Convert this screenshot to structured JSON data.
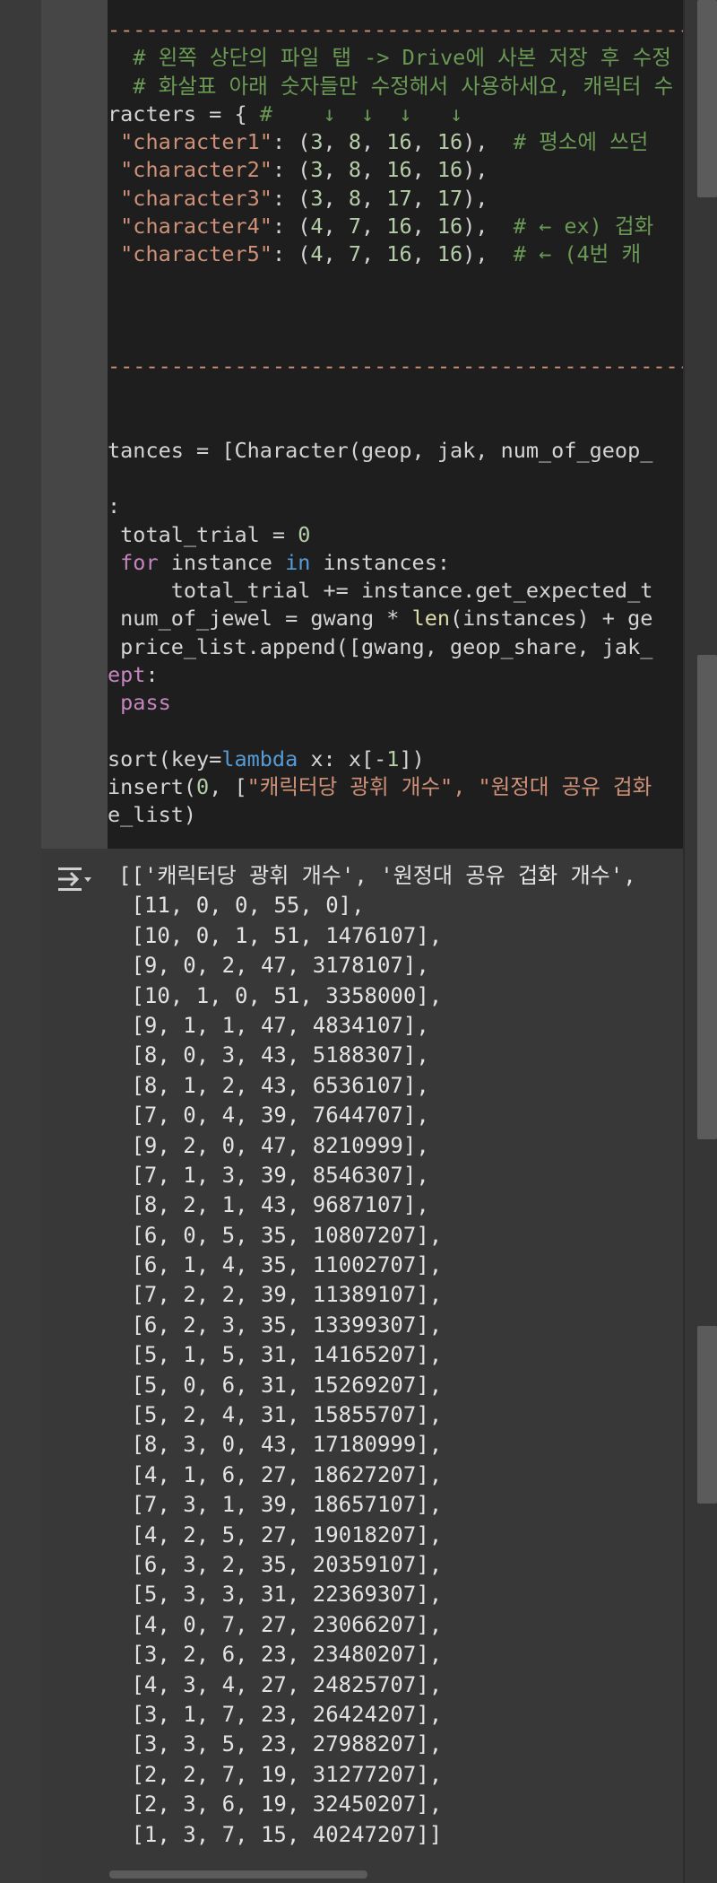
{
  "code_cell": {
    "lines": [
      {
        "segments": [
          {
            "t": "--------------------------------------------------------------",
            "c": "str"
          }
        ]
      },
      {
        "segments": [
          {
            "t": "  # 왼쪽 상단의 파일 탭 -> Drive에 사본 저장 후 수정",
            "c": "cm"
          }
        ]
      },
      {
        "segments": [
          {
            "t": "  # 화살표 아래 숫자들만 수정해서 사용하세요, 캐릭터 수",
            "c": "cm"
          }
        ]
      },
      {
        "segments": [
          {
            "t": "racters = { ",
            "c": ""
          },
          {
            "t": "#    ↓  ↓  ↓   ↓",
            "c": "cm"
          }
        ]
      },
      {
        "segments": [
          {
            "t": " \"character1\"",
            "c": "str"
          },
          {
            "t": ": (",
            "c": ""
          },
          {
            "t": "3",
            "c": "num"
          },
          {
            "t": ", ",
            "c": ""
          },
          {
            "t": "8",
            "c": "num"
          },
          {
            "t": ", ",
            "c": ""
          },
          {
            "t": "16",
            "c": "num"
          },
          {
            "t": ", ",
            "c": ""
          },
          {
            "t": "16",
            "c": "num"
          },
          {
            "t": "),  ",
            "c": ""
          },
          {
            "t": "# 평소에 쓰던",
            "c": "cm"
          }
        ]
      },
      {
        "segments": [
          {
            "t": " \"character2\"",
            "c": "str"
          },
          {
            "t": ": (",
            "c": ""
          },
          {
            "t": "3",
            "c": "num"
          },
          {
            "t": ", ",
            "c": ""
          },
          {
            "t": "8",
            "c": "num"
          },
          {
            "t": ", ",
            "c": ""
          },
          {
            "t": "16",
            "c": "num"
          },
          {
            "t": ", ",
            "c": ""
          },
          {
            "t": "16",
            "c": "num"
          },
          {
            "t": "),",
            "c": ""
          }
        ]
      },
      {
        "segments": [
          {
            "t": " \"character3\"",
            "c": "str"
          },
          {
            "t": ": (",
            "c": ""
          },
          {
            "t": "3",
            "c": "num"
          },
          {
            "t": ", ",
            "c": ""
          },
          {
            "t": "8",
            "c": "num"
          },
          {
            "t": ", ",
            "c": ""
          },
          {
            "t": "17",
            "c": "num"
          },
          {
            "t": ", ",
            "c": ""
          },
          {
            "t": "17",
            "c": "num"
          },
          {
            "t": "),",
            "c": ""
          }
        ]
      },
      {
        "segments": [
          {
            "t": " \"character4\"",
            "c": "str"
          },
          {
            "t": ": (",
            "c": ""
          },
          {
            "t": "4",
            "c": "num"
          },
          {
            "t": ", ",
            "c": ""
          },
          {
            "t": "7",
            "c": "num"
          },
          {
            "t": ", ",
            "c": ""
          },
          {
            "t": "16",
            "c": "num"
          },
          {
            "t": ", ",
            "c": ""
          },
          {
            "t": "16",
            "c": "num"
          },
          {
            "t": "),  ",
            "c": ""
          },
          {
            "t": "# ← ex) 겁화",
            "c": "cm"
          }
        ]
      },
      {
        "segments": [
          {
            "t": " \"character5\"",
            "c": "str"
          },
          {
            "t": ": (",
            "c": ""
          },
          {
            "t": "4",
            "c": "num"
          },
          {
            "t": ", ",
            "c": ""
          },
          {
            "t": "7",
            "c": "num"
          },
          {
            "t": ", ",
            "c": ""
          },
          {
            "t": "16",
            "c": "num"
          },
          {
            "t": ", ",
            "c": ""
          },
          {
            "t": "16",
            "c": "num"
          },
          {
            "t": "),  ",
            "c": ""
          },
          {
            "t": "# ← (4번 캐",
            "c": "cm"
          }
        ]
      },
      {
        "segments": []
      },
      {
        "segments": []
      },
      {
        "segments": []
      },
      {
        "segments": [
          {
            "t": "--------------------------------------------------------------",
            "c": "str"
          }
        ]
      },
      {
        "segments": []
      },
      {
        "segments": []
      },
      {
        "segments": [
          {
            "t": "tances = [Character(geop, jak, num_of_geop_",
            "c": ""
          }
        ]
      },
      {
        "segments": []
      },
      {
        "segments": [
          {
            "t": ":",
            "c": ""
          }
        ]
      },
      {
        "segments": [
          {
            "t": " total_trial = ",
            "c": ""
          },
          {
            "t": "0",
            "c": "num"
          }
        ]
      },
      {
        "segments": [
          {
            "t": " for",
            "c": "kw"
          },
          {
            "t": " instance ",
            "c": ""
          },
          {
            "t": "in",
            "c": "kwb"
          },
          {
            "t": " instances:",
            "c": ""
          }
        ]
      },
      {
        "segments": [
          {
            "t": "     total_trial += instance.get_expected_t",
            "c": ""
          }
        ]
      },
      {
        "segments": [
          {
            "t": " num_of_jewel = gwang * ",
            "c": ""
          },
          {
            "t": "len",
            "c": "fn"
          },
          {
            "t": "(instances) + ge",
            "c": ""
          }
        ]
      },
      {
        "segments": [
          {
            "t": " price_list.append([gwang, geop_share, jak_",
            "c": ""
          }
        ]
      },
      {
        "segments": [
          {
            "t": "ept",
            "c": "kw"
          },
          {
            "t": ":",
            "c": ""
          }
        ]
      },
      {
        "segments": [
          {
            "t": " pass",
            "c": "kw"
          }
        ]
      },
      {
        "segments": []
      },
      {
        "segments": [
          {
            "t": "sort(key=",
            "c": ""
          },
          {
            "t": "lambda",
            "c": "kwb"
          },
          {
            "t": " x: x[-",
            "c": ""
          },
          {
            "t": "1",
            "c": "num"
          },
          {
            "t": "])",
            "c": ""
          }
        ]
      },
      {
        "segments": [
          {
            "t": "insert(",
            "c": ""
          },
          {
            "t": "0",
            "c": "num"
          },
          {
            "t": ", [",
            "c": ""
          },
          {
            "t": "\"캐릭터당 광휘 개수\", \"원정대 공유 겁화 ",
            "c": "str"
          }
        ]
      },
      {
        "segments": [
          {
            "t": "e_list)",
            "c": ""
          }
        ]
      }
    ]
  },
  "output_cell": {
    "icon": "output-collapse-icon",
    "lines": [
      "[['캐릭터당 광휘 개수', '원정대 공유 겁화 개수',",
      " [11, 0, 0, 55, 0],",
      " [10, 0, 1, 51, 1476107],",
      " [9, 0, 2, 47, 3178107],",
      " [10, 1, 0, 51, 3358000],",
      " [9, 1, 1, 47, 4834107],",
      " [8, 0, 3, 43, 5188307],",
      " [8, 1, 2, 43, 6536107],",
      " [7, 0, 4, 39, 7644707],",
      " [9, 2, 0, 47, 8210999],",
      " [7, 1, 3, 39, 8546307],",
      " [8, 2, 1, 43, 9687107],",
      " [6, 0, 5, 35, 10807207],",
      " [6, 1, 4, 35, 11002707],",
      " [7, 2, 2, 39, 11389107],",
      " [6, 2, 3, 35, 13399307],",
      " [5, 1, 5, 31, 14165207],",
      " [5, 0, 6, 31, 15269207],",
      " [5, 2, 4, 31, 15855707],",
      " [8, 3, 0, 43, 17180999],",
      " [4, 1, 6, 27, 18627207],",
      " [7, 3, 1, 39, 18657107],",
      " [4, 2, 5, 27, 19018207],",
      " [6, 3, 2, 35, 20359107],",
      " [5, 3, 3, 31, 22369307],",
      " [4, 0, 7, 27, 23066207],",
      " [3, 2, 6, 23, 23480207],",
      " [4, 3, 4, 27, 24825707],",
      " [3, 1, 7, 23, 26424207],",
      " [3, 3, 5, 23, 27988207],",
      " [2, 2, 7, 19, 31277207],",
      " [2, 3, 6, 19, 32450207],",
      " [1, 3, 7, 15, 40247207]]"
    ]
  }
}
